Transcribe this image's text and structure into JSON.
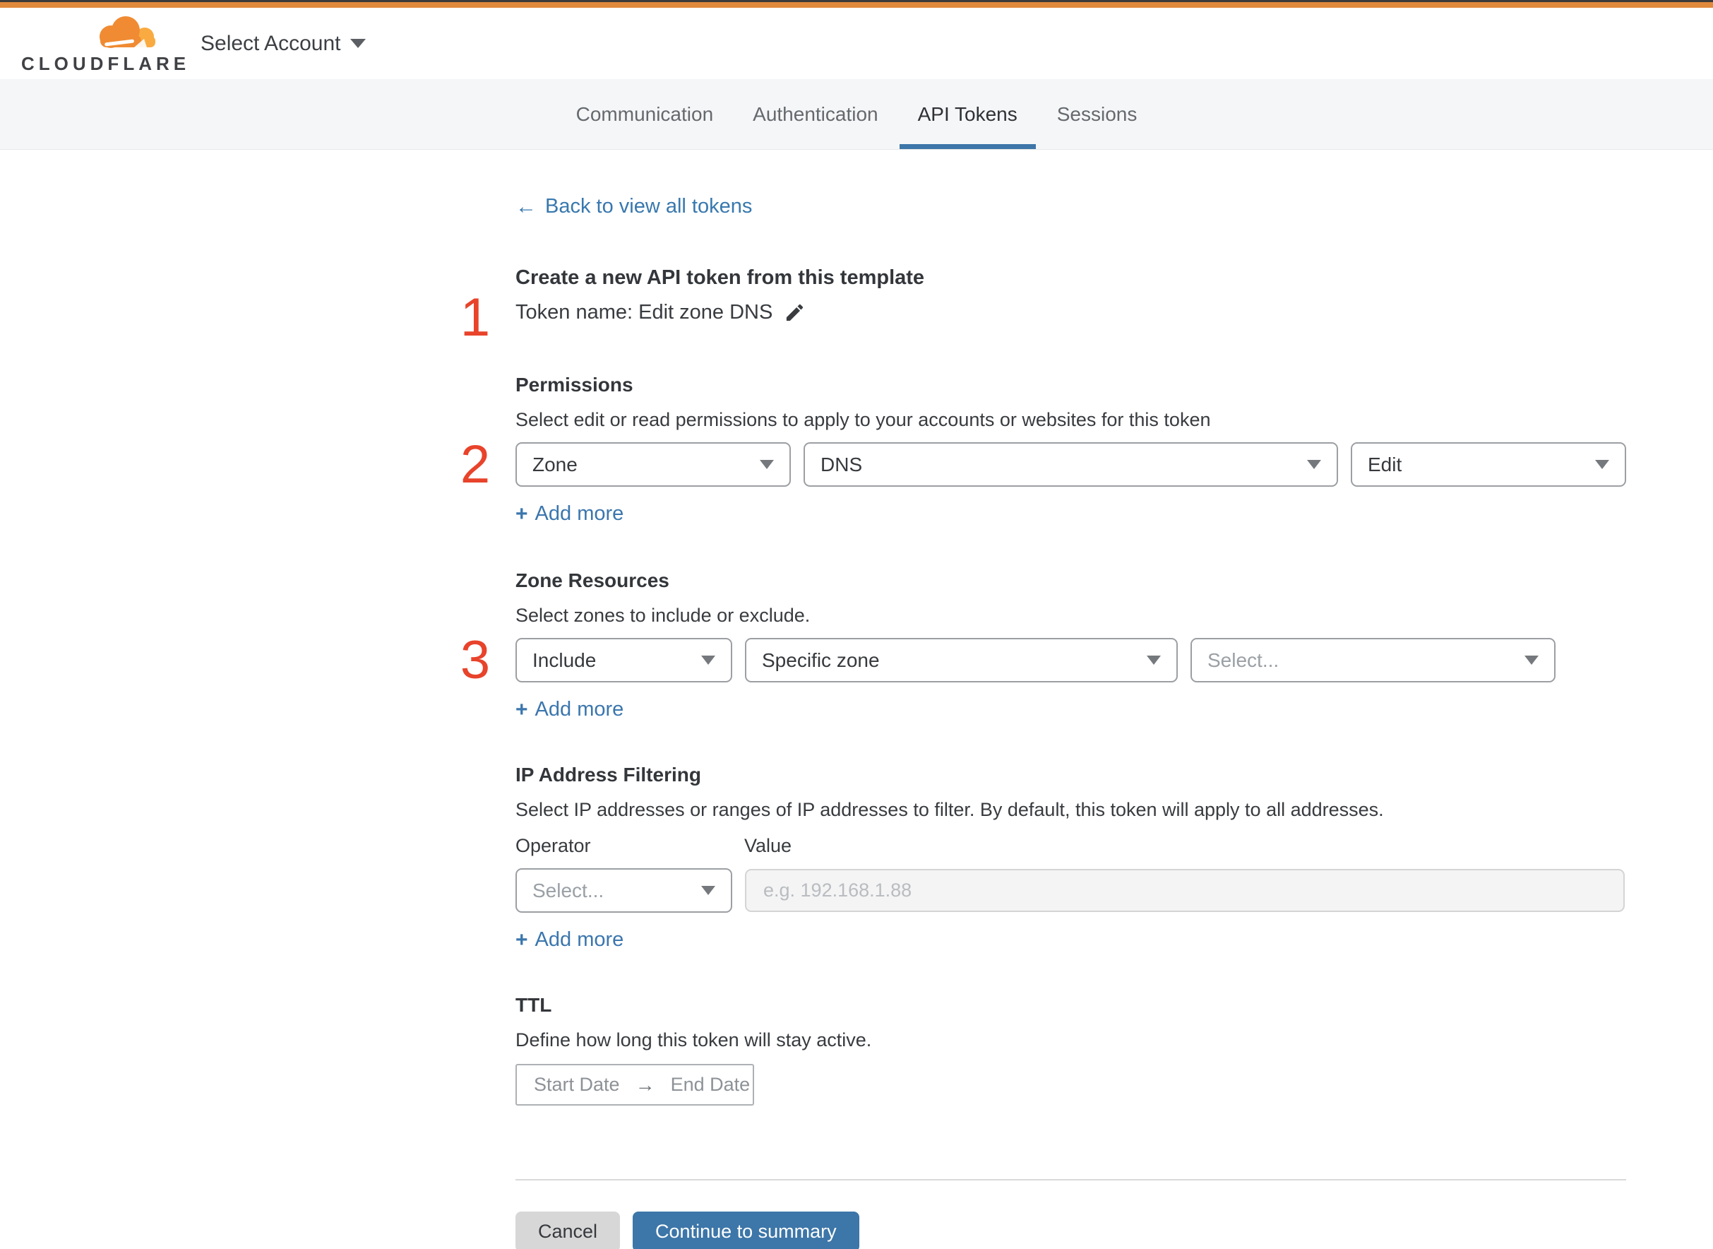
{
  "colors": {
    "top_bar_orange": "#e0893c",
    "brand_cloud_orange": "#f08b33",
    "brand_cloud_light": "#f9ab41",
    "step_number_red": "#e8432b",
    "link_blue": "#3878ae",
    "button_blue": "#3d76a8",
    "active_tab_underline": "#3d76a8"
  },
  "header": {
    "logo_text": "CLOUDFLARE",
    "account_selector_label": "Select Account"
  },
  "tabs": {
    "items": [
      {
        "label": "Communication",
        "active": false
      },
      {
        "label": "Authentication",
        "active": false
      },
      {
        "label": "API Tokens",
        "active": true
      },
      {
        "label": "Sessions",
        "active": false
      }
    ]
  },
  "icons": {
    "back_arrow": "←",
    "date_range_arrow": "→",
    "add_more_plus": "+"
  },
  "back_link": {
    "label": "Back to view all tokens"
  },
  "token_template": {
    "step_number": "1",
    "heading": "Create a new API token from this template",
    "token_name": "Token name: Edit zone DNS"
  },
  "permissions": {
    "step_number": "2",
    "heading": "Permissions",
    "description": "Select edit or read permissions to apply to your accounts or websites for this token",
    "scope_select": "Zone",
    "service_select": "DNS",
    "access_select": "Edit",
    "add_more": "Add more"
  },
  "zone_resources": {
    "step_number": "3",
    "heading": "Zone Resources",
    "description": "Select zones to include or exclude.",
    "mode_select": "Include",
    "type_select": "Specific zone",
    "zone_select_placeholder": "Select...",
    "add_more": "Add more"
  },
  "ip_filtering": {
    "heading": "IP Address Filtering",
    "description": "Select IP addresses or ranges of IP addresses to filter. By default, this token will apply to all addresses.",
    "operator_label": "Operator",
    "value_label": "Value",
    "operator_placeholder": "Select...",
    "value_placeholder": "e.g. 192.168.1.88",
    "add_more": "Add more"
  },
  "ttl": {
    "heading": "TTL",
    "description": "Define how long this token will stay active.",
    "start_date_placeholder": "Start Date",
    "end_date_placeholder": "End Date"
  },
  "footer": {
    "cancel_label": "Cancel",
    "continue_label": "Continue to summary"
  }
}
